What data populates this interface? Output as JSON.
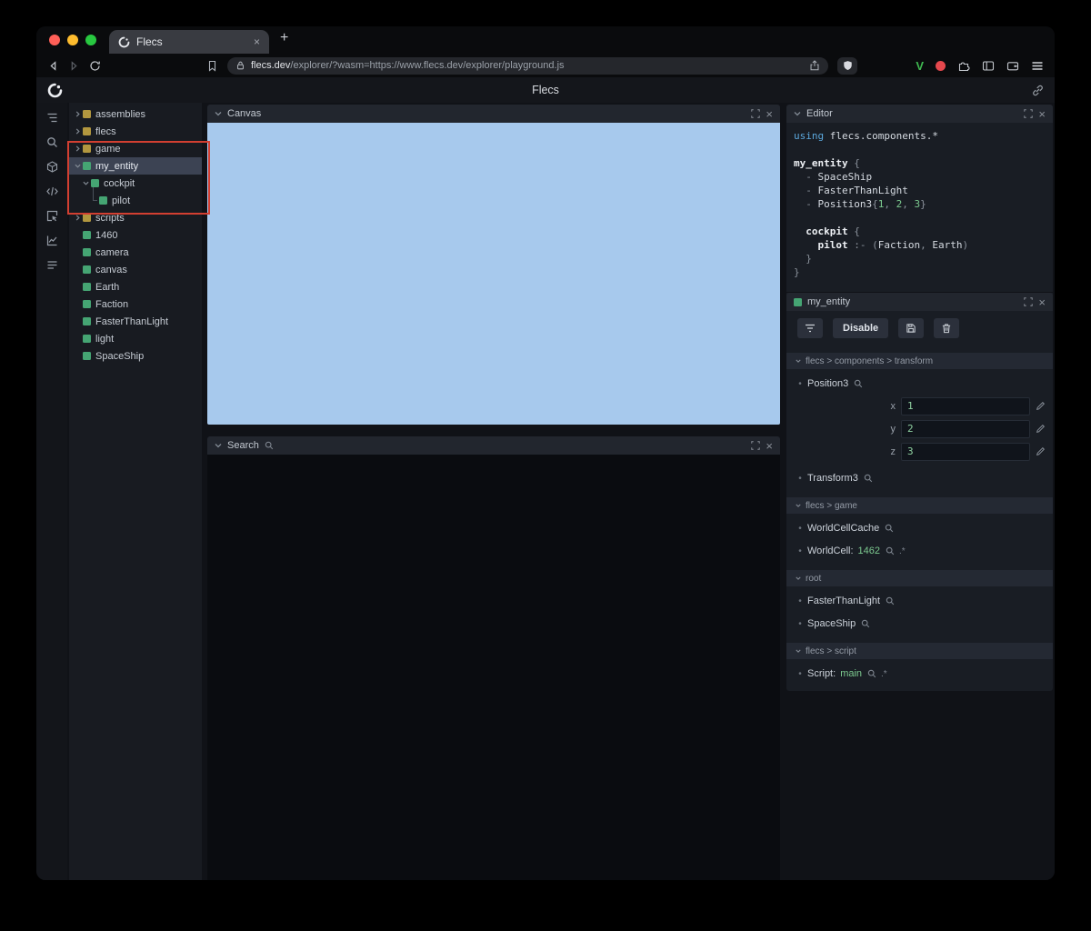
{
  "colors": {
    "entity_green": "#45a573",
    "module_yellow": "#b2973f",
    "canvas_blue": "#a7c9ed",
    "annotation_red": "#d23f31",
    "code_keyword_blue": "#5ca8dd",
    "code_number_green": "#7cc98f",
    "traffic_red": "#ff5f57",
    "traffic_yellow": "#febc2e",
    "traffic_green": "#28c840",
    "extension_v_green": "#3fb950",
    "extension_dot_red": "#e5484d"
  },
  "browser": {
    "tab": {
      "title": "Flecs"
    },
    "new_tab_button": "+",
    "url": {
      "domain": "flecs.dev",
      "path": "/explorer/?wasm=https://www.flecs.dev/explorer/playground.js"
    }
  },
  "app": {
    "title": "Flecs",
    "tree": {
      "items": [
        {
          "label": "assemblies",
          "kind": "module",
          "depth": 0,
          "state": "collapsed"
        },
        {
          "label": "flecs",
          "kind": "module",
          "depth": 0,
          "state": "collapsed"
        },
        {
          "label": "game",
          "kind": "module",
          "depth": 0,
          "state": "collapsed"
        },
        {
          "label": "my_entity",
          "kind": "entity",
          "depth": 0,
          "state": "expanded",
          "selected": true
        },
        {
          "label": "cockpit",
          "kind": "entity",
          "depth": 1,
          "state": "expanded"
        },
        {
          "label": "pilot",
          "kind": "entity",
          "depth": 2,
          "connector": true
        },
        {
          "label": "scripts",
          "kind": "module",
          "depth": 0,
          "state": "collapsed"
        },
        {
          "label": "1460",
          "kind": "entity",
          "depth": 0
        },
        {
          "label": "camera",
          "kind": "entity",
          "depth": 0
        },
        {
          "label": "canvas",
          "kind": "entity",
          "depth": 0
        },
        {
          "label": "Earth",
          "kind": "entity",
          "depth": 0
        },
        {
          "label": "Faction",
          "kind": "entity",
          "depth": 0
        },
        {
          "label": "FasterThanLight",
          "kind": "entity",
          "depth": 0
        },
        {
          "label": "light",
          "kind": "entity",
          "depth": 0
        },
        {
          "label": "SpaceShip",
          "kind": "entity",
          "depth": 0
        }
      ]
    },
    "canvas_panel": {
      "title": "Canvas"
    },
    "search_panel": {
      "title": "Search"
    },
    "editor": {
      "title": "Editor",
      "lines": [
        [
          {
            "t": "using",
            "c": "kw"
          },
          {
            "t": " flecs.components.*",
            "c": "id"
          }
        ],
        [],
        [
          {
            "t": "my_entity",
            "c": "entity"
          },
          {
            "t": " {",
            "c": "punct"
          }
        ],
        [
          {
            "t": "  - ",
            "c": "punct"
          },
          {
            "t": "SpaceShip",
            "c": "id"
          }
        ],
        [
          {
            "t": "  - ",
            "c": "punct"
          },
          {
            "t": "FasterThanLight",
            "c": "id"
          }
        ],
        [
          {
            "t": "  - ",
            "c": "punct"
          },
          {
            "t": "Position3",
            "c": "id"
          },
          {
            "t": "{",
            "c": "punct"
          },
          {
            "t": "1",
            "c": "num"
          },
          {
            "t": ", ",
            "c": "punct"
          },
          {
            "t": "2",
            "c": "num"
          },
          {
            "t": ", ",
            "c": "punct"
          },
          {
            "t": "3",
            "c": "num"
          },
          {
            "t": "}",
            "c": "punct"
          }
        ],
        [],
        [
          {
            "t": "  ",
            "c": "punct"
          },
          {
            "t": "cockpit",
            "c": "entity"
          },
          {
            "t": " {",
            "c": "punct"
          }
        ],
        [
          {
            "t": "    ",
            "c": "punct"
          },
          {
            "t": "pilot",
            "c": "entity"
          },
          {
            "t": " :- (",
            "c": "punct"
          },
          {
            "t": "Faction",
            "c": "id"
          },
          {
            "t": ", ",
            "c": "punct"
          },
          {
            "t": "Earth",
            "c": "id"
          },
          {
            "t": ")",
            "c": "punct"
          }
        ],
        [
          {
            "t": "  }",
            "c": "punct"
          }
        ],
        [
          {
            "t": "}",
            "c": "punct"
          }
        ]
      ]
    },
    "inspector": {
      "title": "my_entity",
      "toolbar": {
        "disable_label": "Disable"
      },
      "sections": [
        {
          "header": "flecs > components > transform",
          "rows": [
            {
              "name": "Position3",
              "search": true,
              "fields": [
                {
                  "label": "x",
                  "value": "1"
                },
                {
                  "label": "y",
                  "value": "2"
                },
                {
                  "label": "z",
                  "value": "3"
                }
              ]
            },
            {
              "name": "Transform3",
              "search": true
            }
          ]
        },
        {
          "header": "flecs > game",
          "rows": [
            {
              "name": "WorldCellCache",
              "search": true
            },
            {
              "name": "WorldCell:",
              "value": "1462",
              "search": true,
              "suffix": ".*"
            }
          ]
        },
        {
          "header": "root",
          "rows": [
            {
              "name": "FasterThanLight",
              "search": true
            },
            {
              "name": "SpaceShip",
              "search": true
            }
          ]
        },
        {
          "header": "flecs > script",
          "rows": [
            {
              "name": "Script:",
              "value": "main",
              "search": true,
              "suffix": ".*"
            }
          ]
        }
      ]
    }
  }
}
